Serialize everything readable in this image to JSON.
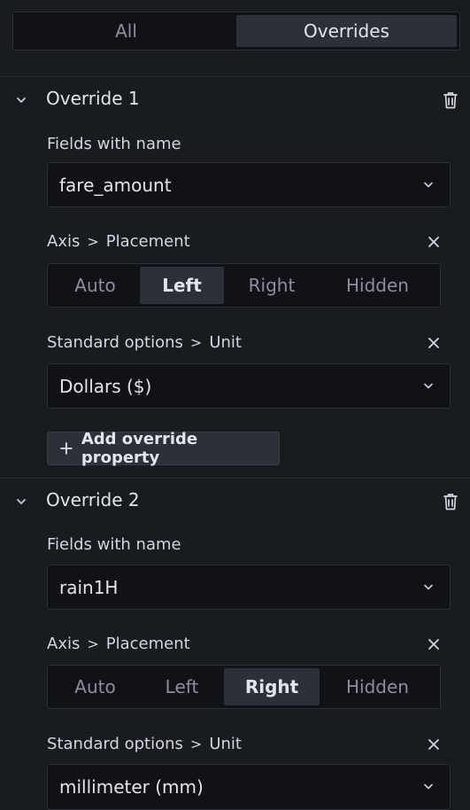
{
  "tabs": {
    "all": "All",
    "overrides": "Overrides"
  },
  "overrides": [
    {
      "title": "Override 1",
      "matcher_label": "Fields with name",
      "matcher_value": "fare_amount",
      "prop1": {
        "group": "Axis",
        "name": "Placement",
        "options": [
          "Auto",
          "Left",
          "Right",
          "Hidden"
        ],
        "selected": "Left"
      },
      "prop2": {
        "group": "Standard options",
        "name": "Unit",
        "value": "Dollars ($)"
      },
      "add_label": "Add override property"
    },
    {
      "title": "Override 2",
      "matcher_label": "Fields with name",
      "matcher_value": "rain1H",
      "prop1": {
        "group": "Axis",
        "name": "Placement",
        "options": [
          "Auto",
          "Left",
          "Right",
          "Hidden"
        ],
        "selected": "Right"
      },
      "prop2": {
        "group": "Standard options",
        "name": "Unit",
        "value": "millimeter (mm)"
      }
    }
  ],
  "separator": ">",
  "icons": {
    "collapse": "chevron-down-icon",
    "delete": "trash-icon",
    "remove": "close-icon",
    "dropdown": "chevron-down-icon",
    "add": "plus-icon"
  },
  "colors": {
    "background": "#181b1f",
    "input_background": "#111217",
    "active_segment": "#2c3038",
    "text": "#ccccdc"
  }
}
